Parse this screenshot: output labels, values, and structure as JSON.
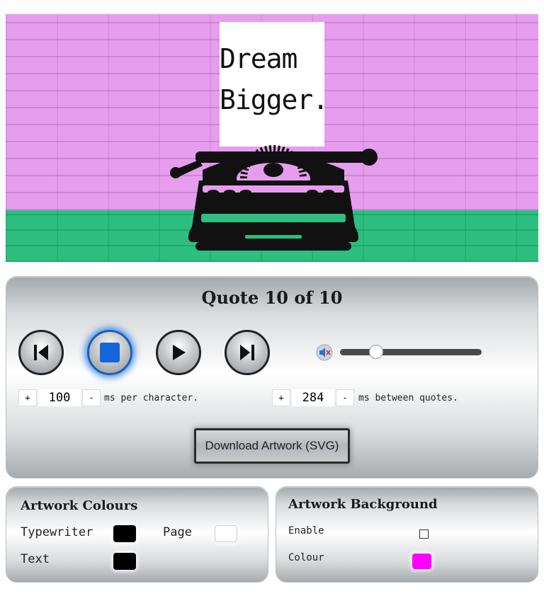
{
  "artwork": {
    "quote_lines": [
      "Dream",
      "Bigger."
    ],
    "wall_color": "#e79ded",
    "floor_color": "#2cbf7f",
    "page_color": "#ffffff",
    "text_color": "#000000",
    "typewriter_color": "#000000"
  },
  "controls": {
    "title": "Quote 10 of 10",
    "buttons": [
      "previous-icon",
      "stop-icon",
      "play-icon",
      "next-icon"
    ],
    "volume_icon": "speaker-muted-icon",
    "volume_level": 0.23,
    "char_speed": {
      "plus": "+",
      "value": "100",
      "minus": "-",
      "label": "ms per character."
    },
    "quote_delay": {
      "plus": "+",
      "value": "284",
      "minus": "-",
      "label": "ms between quotes."
    },
    "download_label": "Download Artwork (SVG)"
  },
  "colours": {
    "title": "Artwork Colours",
    "typewriter_label": "Typewriter",
    "page_label": "Page",
    "text_label": "Text",
    "typewriter_color": "#000000",
    "page_color": "#ffffff",
    "text_color": "#000000"
  },
  "background": {
    "title": "Artwork Background",
    "enable_label": "Enable",
    "enabled": false,
    "colour_label": "Colour",
    "colour": "#ff00ff"
  }
}
